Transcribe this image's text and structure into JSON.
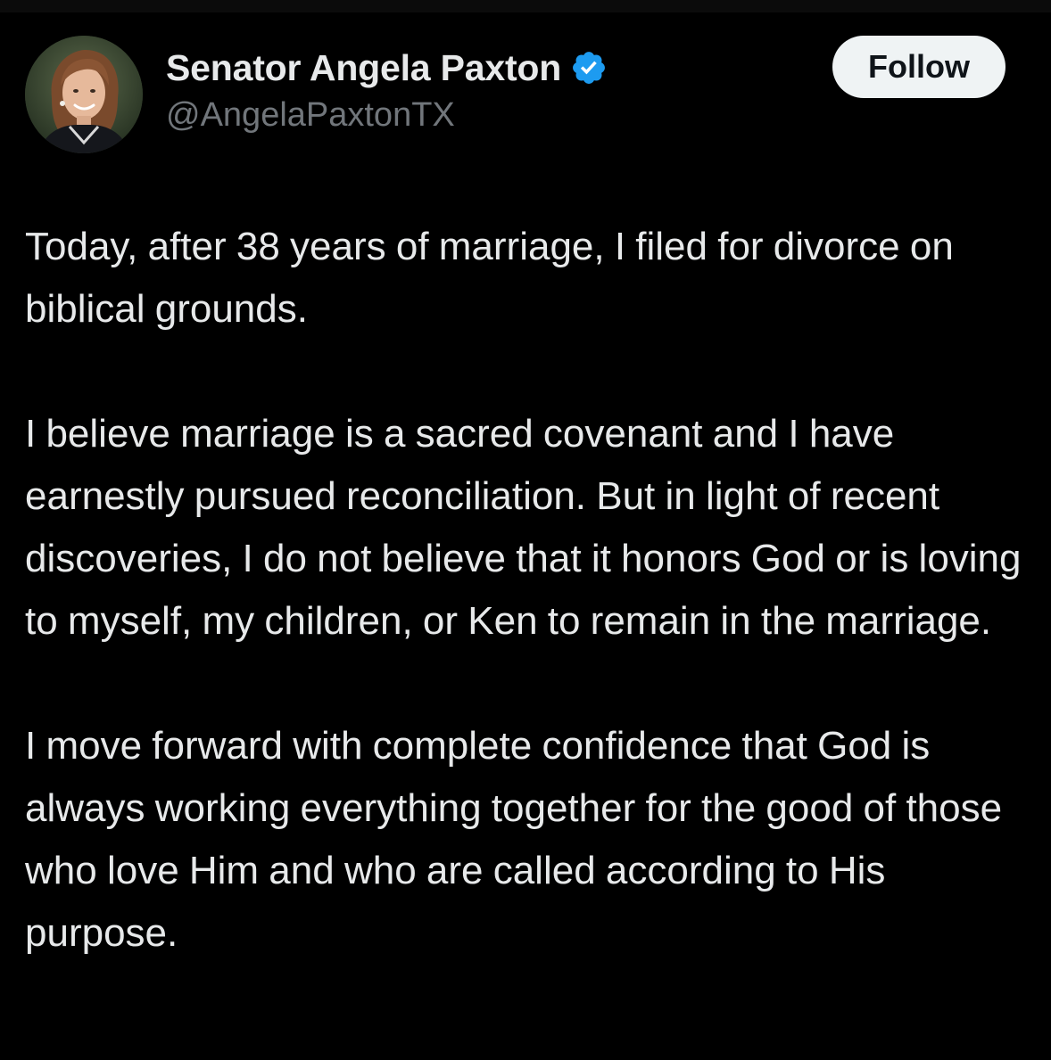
{
  "tweet": {
    "author": {
      "display_name": "Senator Angela Paxton",
      "handle": "@AngelaPaxtonTX",
      "verified": true,
      "verified_badge_color": "#1d9bf0",
      "avatar_icon": "profile-photo"
    },
    "follow_label": "Follow",
    "paragraphs": [
      "Today, after 38 years of marriage, I filed for divorce on biblical grounds.",
      "I believe marriage is a sacred covenant and I have earnestly pursued reconciliation. But in light of recent discoveries, I do not believe that it honors God or is loving to myself, my children, or Ken to remain in the marriage.",
      "I move forward with complete confidence that God is always working everything together for the good of those who love Him and who are called according to His purpose."
    ]
  },
  "colors": {
    "background": "#000000",
    "text_primary": "#e7e9ea",
    "text_secondary": "#71767b",
    "follow_button_bg": "#eff3f4",
    "follow_button_text": "#0f1419"
  }
}
